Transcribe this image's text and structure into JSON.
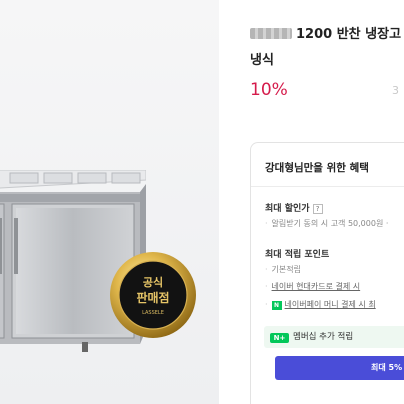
{
  "product": {
    "title": "1200 반찬 냉장고",
    "title_line2": "냉식",
    "discount": "10%",
    "price_faded": "3"
  },
  "badge": {
    "line1": "공식",
    "line2": "판매점",
    "brand": "LASSELE"
  },
  "benefits": {
    "title": "강대형님만을 위한 혜택",
    "max_discount": {
      "label": "최대 할인가",
      "help": "?",
      "items": [
        "알림받기 동의 시 고객 50,000원 ·"
      ]
    },
    "max_points": {
      "label": "최대 적립 포인트",
      "items": [
        "기본적립",
        "네이버 현대카드로 결제 시",
        "네이버페이 머니 결제 시 최"
      ]
    },
    "membership": {
      "plus_badge": "N+",
      "label": "멤버십 추가 적립"
    },
    "max_button": "최대 5%"
  },
  "colors": {
    "discount": "#d51b4b",
    "naver_green": "#03c75a",
    "button_blue": "#4a4dd8"
  }
}
